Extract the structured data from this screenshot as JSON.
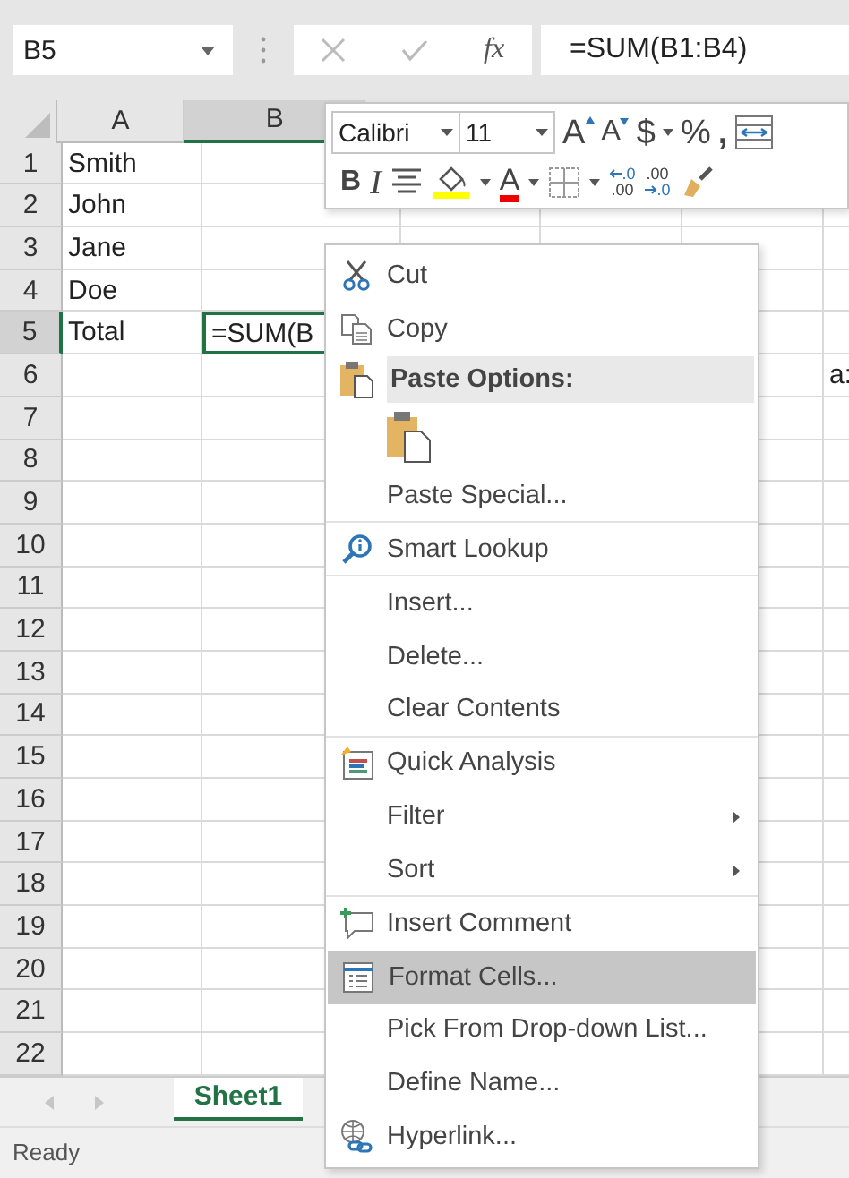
{
  "formula_bar": {
    "name_box": "B5",
    "fx": "fx",
    "formula": "=SUM(B1:B4)"
  },
  "columns": [
    {
      "label": "A",
      "selected": false
    },
    {
      "label": "B",
      "selected": true
    }
  ],
  "rows": [
    {
      "number": "1",
      "col_a": "Smith",
      "selected": false
    },
    {
      "number": "2",
      "col_a": "John",
      "selected": false
    },
    {
      "number": "3",
      "col_a": "Jane",
      "selected": false
    },
    {
      "number": "4",
      "col_a": "Doe",
      "selected": false
    },
    {
      "number": "5",
      "col_a": "Total",
      "col_b": "=SUM(B",
      "selected": true
    },
    {
      "number": "6",
      "col_f": "a:",
      "selected": false
    },
    {
      "number": "7",
      "selected": false
    },
    {
      "number": "8",
      "selected": false
    },
    {
      "number": "9",
      "selected": false
    },
    {
      "number": "10",
      "selected": false
    },
    {
      "number": "11",
      "selected": false
    },
    {
      "number": "12",
      "selected": false
    },
    {
      "number": "13",
      "selected": false
    },
    {
      "number": "14",
      "selected": false
    },
    {
      "number": "15",
      "selected": false
    },
    {
      "number": "16",
      "selected": false
    },
    {
      "number": "17",
      "selected": false
    },
    {
      "number": "18",
      "selected": false
    },
    {
      "number": "19",
      "selected": false
    },
    {
      "number": "20",
      "selected": false
    },
    {
      "number": "21",
      "selected": false
    },
    {
      "number": "22",
      "selected": false
    }
  ],
  "mini_toolbar": {
    "font_name": "Calibri",
    "font_size": "11",
    "row1": [
      {
        "kind": "grow",
        "label": "A"
      },
      {
        "kind": "shrink",
        "label": "A"
      },
      {
        "kind": "currency",
        "label": "$"
      },
      {
        "kind": "percent",
        "label": "%"
      },
      {
        "kind": "comma",
        "label": ","
      },
      {
        "kind": "wrap"
      }
    ],
    "row2": [
      {
        "kind": "bold",
        "label": "B"
      },
      {
        "kind": "italic",
        "label": "I"
      },
      {
        "kind": "center"
      },
      {
        "kind": "fill"
      },
      {
        "kind": "fontcolor",
        "label": "A"
      },
      {
        "kind": "borders"
      },
      {
        "kind": "incdec",
        "label": ".0",
        "label2": ".00"
      },
      {
        "kind": "decdec",
        "label": ".00",
        "label2": ".0"
      },
      {
        "kind": "painter"
      }
    ]
  },
  "context_menu": [
    {
      "kind": "cut",
      "label": "Cut",
      "selected": false
    },
    {
      "kind": "copy",
      "label": "Copy",
      "selected": false
    },
    {
      "kind": "paste-header",
      "label": "Paste Options:"
    },
    {
      "kind": "paste-button"
    },
    {
      "kind": "plain",
      "label": "Paste Special...",
      "selected": false,
      "separator_after": true
    },
    {
      "kind": "lookup",
      "label": "Smart Lookup",
      "selected": false,
      "separator_after": true
    },
    {
      "kind": "plain",
      "label": "Insert...",
      "selected": false
    },
    {
      "kind": "plain",
      "label": "Delete...",
      "selected": false
    },
    {
      "kind": "plain",
      "label": "Clear Contents",
      "selected": false,
      "separator_after": true
    },
    {
      "kind": "analysis",
      "label": "Quick Analysis",
      "selected": false
    },
    {
      "kind": "plain",
      "label": "Filter",
      "submenu": true,
      "selected": false
    },
    {
      "kind": "plain",
      "label": "Sort",
      "submenu": true,
      "selected": false,
      "separator_after": true
    },
    {
      "kind": "comment",
      "label": "Insert Comment",
      "selected": false
    },
    {
      "kind": "format",
      "label": "Format Cells...",
      "selected": true
    },
    {
      "kind": "plain",
      "label": "Pick From Drop-down List...",
      "selected": false
    },
    {
      "kind": "plain",
      "label": "Define Name...",
      "selected": false
    },
    {
      "kind": "link",
      "label": "Hyperlink...",
      "selected": false
    }
  ],
  "sheet_tabs": [
    {
      "label": "Sheet1",
      "selected": true
    }
  ],
  "status_bar": "Ready"
}
